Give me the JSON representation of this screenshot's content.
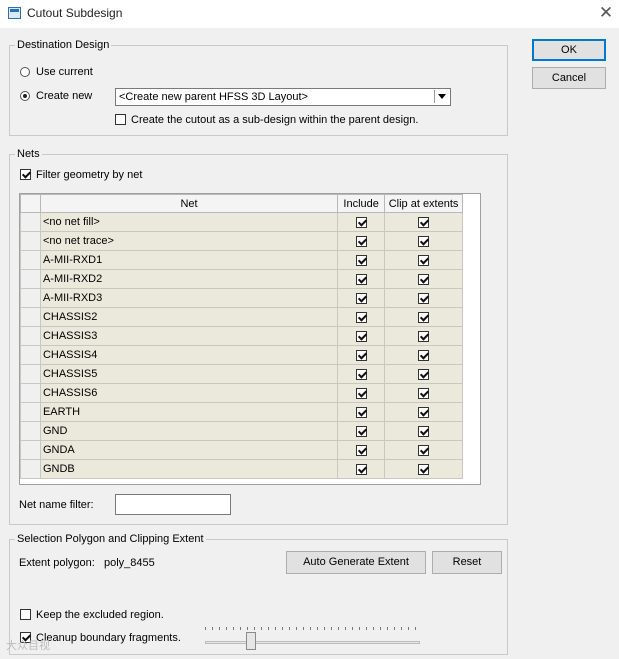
{
  "window": {
    "title": "Cutout Subdesign",
    "close_glyph": "✕"
  },
  "buttons": {
    "ok": "OK",
    "cancel": "Cancel"
  },
  "destination": {
    "group_label": "Destination Design",
    "use_current_label": "Use current",
    "create_new_label": "Create new",
    "selected_option": "create_new",
    "combo_value": "<Create new parent HFSS 3D Layout>",
    "subdesign_checkbox_label": "Create the cutout as a sub-design within the parent design.",
    "subdesign_checked": false
  },
  "nets": {
    "group_label": "Nets",
    "filter_label": "Filter geometry by net",
    "filter_checked": true,
    "columns": {
      "net": "Net",
      "include": "Include",
      "clip": "Clip at extents"
    },
    "rows": [
      {
        "name": "<no net fill>",
        "include": true,
        "clip": true
      },
      {
        "name": "<no net trace>",
        "include": true,
        "clip": true
      },
      {
        "name": "A-MII-RXD1",
        "include": true,
        "clip": true
      },
      {
        "name": "A-MII-RXD2",
        "include": true,
        "clip": true
      },
      {
        "name": "A-MII-RXD3",
        "include": true,
        "clip": true
      },
      {
        "name": "CHASSIS2",
        "include": true,
        "clip": true
      },
      {
        "name": "CHASSIS3",
        "include": true,
        "clip": true
      },
      {
        "name": "CHASSIS4",
        "include": true,
        "clip": true
      },
      {
        "name": "CHASSIS5",
        "include": true,
        "clip": true
      },
      {
        "name": "CHASSIS6",
        "include": true,
        "clip": true
      },
      {
        "name": "EARTH",
        "include": true,
        "clip": true
      },
      {
        "name": "GND",
        "include": true,
        "clip": true
      },
      {
        "name": "GNDA",
        "include": true,
        "clip": true
      },
      {
        "name": "GNDB",
        "include": true,
        "clip": true
      }
    ],
    "name_filter_label": "Net name filter:",
    "name_filter_value": ""
  },
  "selection": {
    "group_label": "Selection Polygon and Clipping Extent",
    "extent_label": "Extent polygon:",
    "extent_value": "poly_8455",
    "auto_generate_label": "Auto Generate Extent",
    "reset_label": "Reset",
    "keep_excluded_label": "Keep the excluded region.",
    "keep_excluded_checked": false,
    "cleanup_label": "Cleanup boundary fragments.",
    "cleanup_checked": true,
    "slider_fraction": 0.2
  },
  "watermark": "大众目视"
}
